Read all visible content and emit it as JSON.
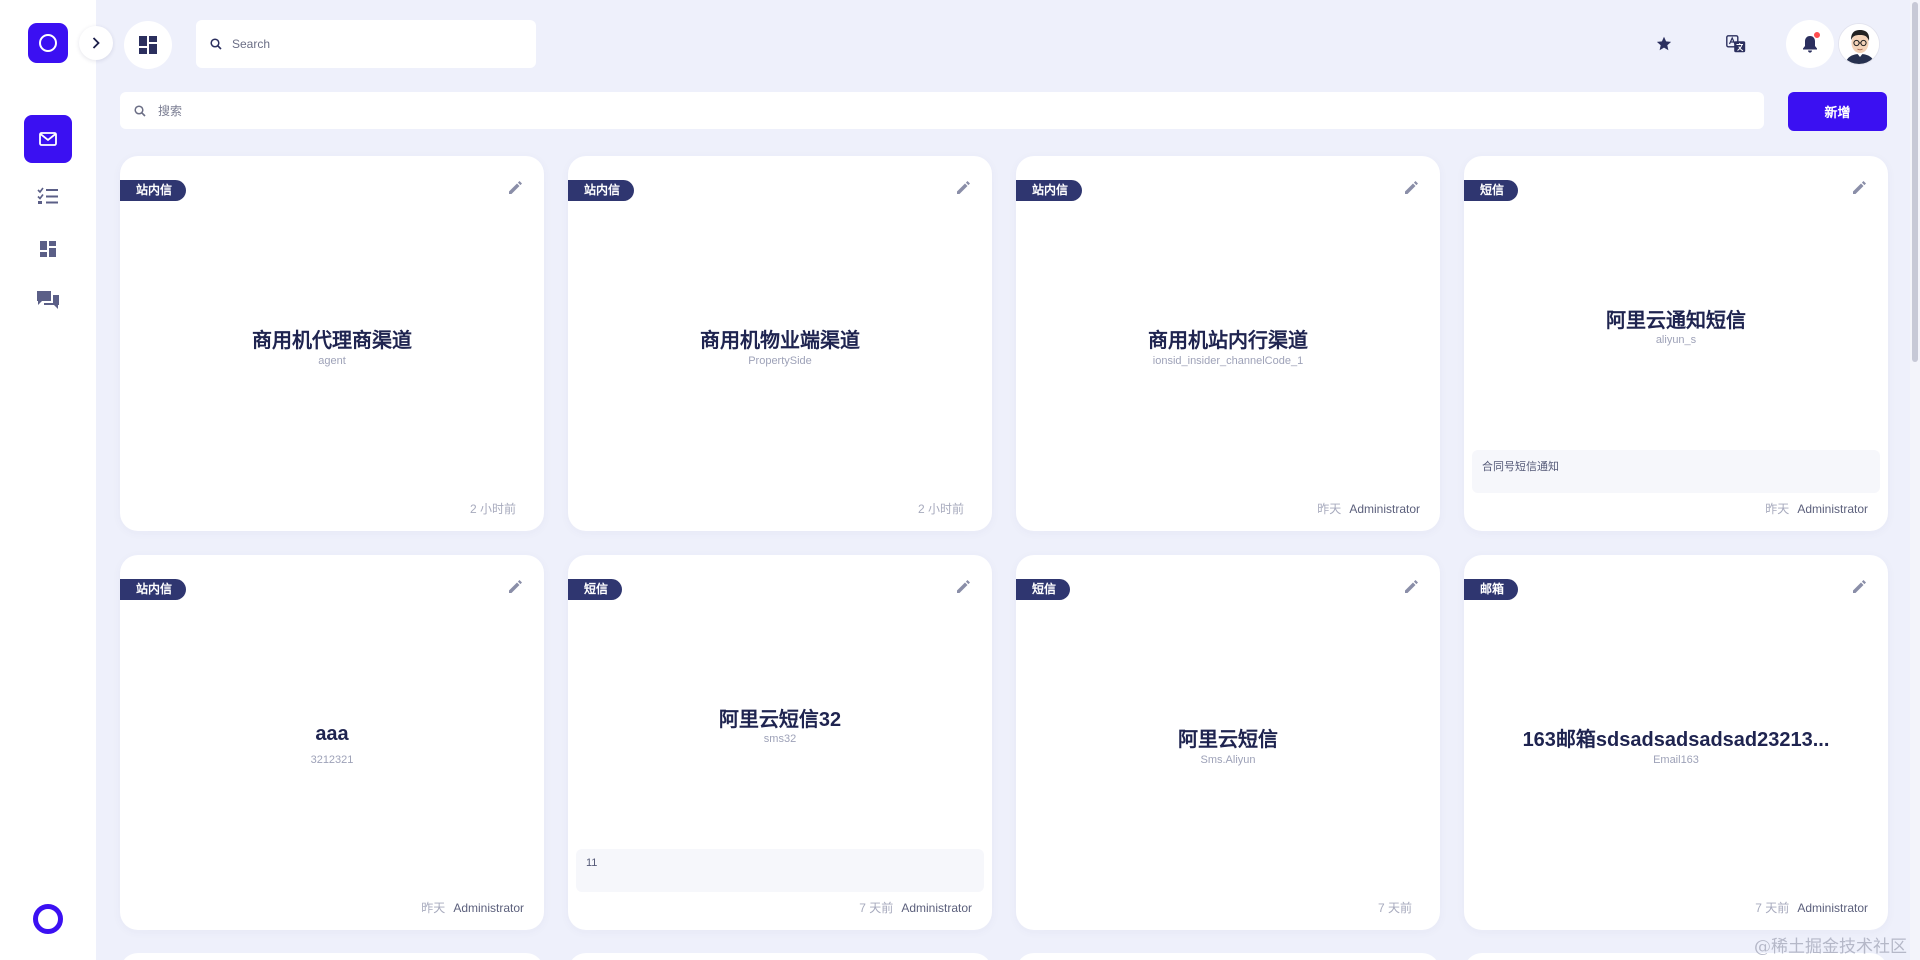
{
  "topbar": {
    "search_placeholder": "Search"
  },
  "main": {
    "search_placeholder": "搜索",
    "add_label": "新增"
  },
  "cards": [
    {
      "tag": "站内信",
      "title": "商用机代理商渠道",
      "code": "agent",
      "desc": "",
      "time": "2 小时前",
      "author": ""
    },
    {
      "tag": "站内信",
      "title": "商用机物业端渠道",
      "code": "PropertySide",
      "desc": "",
      "time": "2 小时前",
      "author": ""
    },
    {
      "tag": "站内信",
      "title": "商用机站内行渠道",
      "code": "ionsid_insider_channelCode_1",
      "desc": "",
      "time": "昨天",
      "author": "Administrator"
    },
    {
      "tag": "短信",
      "title": "阿里云通知短信",
      "code": "aliyun_s",
      "desc": "合同号短信通知",
      "time": "昨天",
      "author": "Administrator"
    },
    {
      "tag": "站内信",
      "title": "aaa",
      "code": "3212321",
      "desc": "",
      "time": "昨天",
      "author": "Administrator"
    },
    {
      "tag": "短信",
      "title": "阿里云短信32",
      "code": "sms32",
      "desc": "11",
      "time": "7 天前",
      "author": "Administrator"
    },
    {
      "tag": "短信",
      "title": "阿里云短信",
      "code": "Sms.Aliyun",
      "desc": "",
      "time": "7 天前",
      "author": ""
    },
    {
      "tag": "邮箱",
      "title": "163邮箱sdsadsadsadsad23213...",
      "code": "Email163",
      "desc": "",
      "time": "7 天前",
      "author": "Administrator"
    }
  ],
  "watermark": "@稀土掘金技术社区",
  "colors": {
    "accent": "#3b10f2",
    "tag_bg": "#2f3670",
    "page_bg": "#eef0fb",
    "notification_dot": "#ff4d4f"
  },
  "icons": {
    "logo": "circle-logo-icon",
    "rail": [
      "mail-icon",
      "checklist-icon",
      "dashboard-icon",
      "chat-icon"
    ],
    "top": [
      "star-icon",
      "translate-icon",
      "bell-icon"
    ]
  }
}
